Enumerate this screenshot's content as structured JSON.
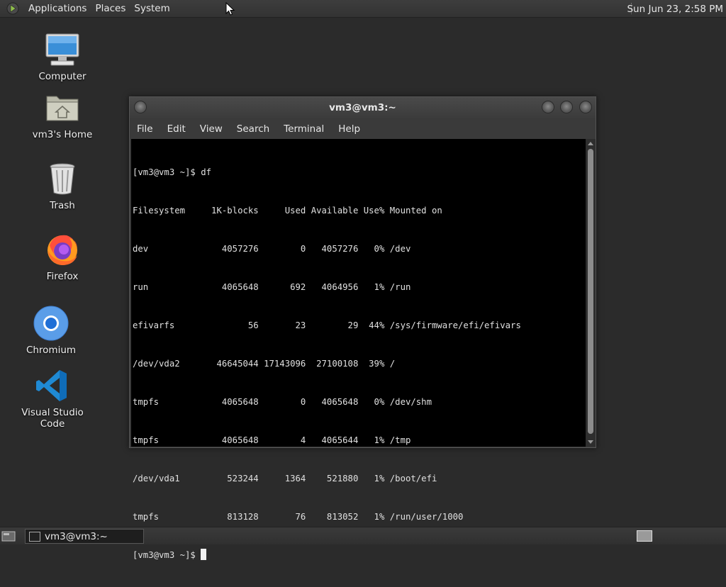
{
  "top_panel": {
    "menus": [
      "Applications",
      "Places",
      "System"
    ],
    "clock": "Sun Jun 23,  2:58 PM"
  },
  "desktop": {
    "icons": [
      {
        "label": "Computer",
        "icon": "computer-icon"
      },
      {
        "label": "vm3's Home",
        "icon": "home-folder-icon"
      },
      {
        "label": "Trash",
        "icon": "trash-icon"
      },
      {
        "label": "Firefox",
        "icon": "firefox-icon"
      },
      {
        "label": "Chromium",
        "icon": "chromium-icon"
      },
      {
        "label": "Visual Studio Code",
        "icon": "vscode-icon"
      }
    ]
  },
  "terminal": {
    "title": "vm3@vm3:~",
    "menus": [
      "File",
      "Edit",
      "View",
      "Search",
      "Terminal",
      "Help"
    ],
    "lines": [
      "[vm3@vm3 ~]$ df",
      "Filesystem     1K-blocks     Used Available Use% Mounted on",
      "dev              4057276        0   4057276   0% /dev",
      "run              4065648      692   4064956   1% /run",
      "efivarfs              56       23        29  44% /sys/firmware/efi/efivars",
      "/dev/vda2       46645044 17143096  27100108  39% /",
      "tmpfs            4065648        0   4065648   0% /dev/shm",
      "tmpfs            4065648        4   4065644   1% /tmp",
      "/dev/vda1         523244     1364    521880   1% /boot/efi",
      "tmpfs             813128       76    813052   1% /run/user/1000"
    ],
    "prompt": "[vm3@vm3 ~]$ "
  },
  "bottom_panel": {
    "task_label": "vm3@vm3:~"
  },
  "colors": {
    "desktop_bg": "#2b2b2b",
    "terminal_bg": "#000000",
    "terminal_fg": "#e0e0e0"
  }
}
